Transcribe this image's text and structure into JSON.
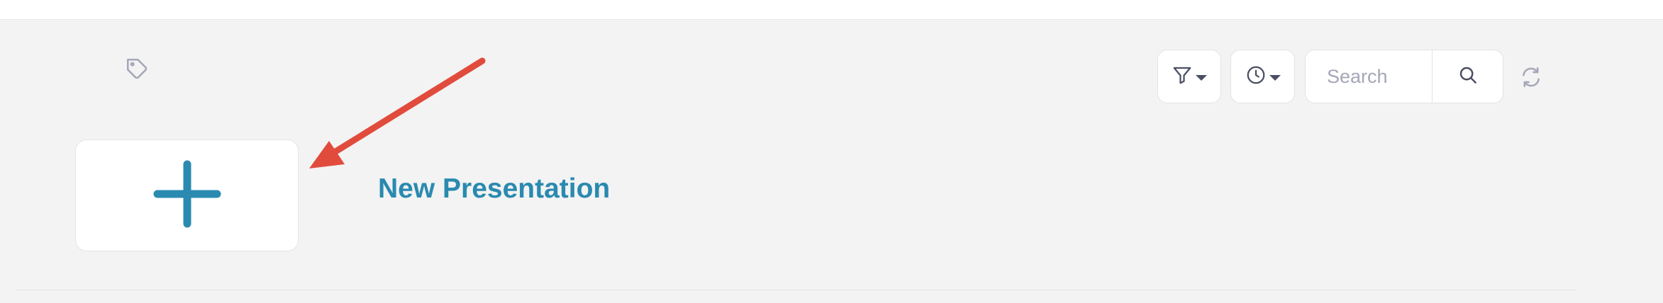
{
  "search": {
    "placeholder": "Search"
  },
  "new_item": {
    "label": "New Presentation"
  },
  "colors": {
    "accent": "#2a8ab0",
    "annotation_arrow": "#e14b3c",
    "icon": "#4b4f63",
    "muted_icon": "#a5a7b8"
  },
  "icons": {
    "tag": "tag-icon",
    "filter": "filter-icon",
    "history": "clock-icon",
    "search": "search-icon",
    "refresh": "refresh-icon",
    "add": "plus-icon"
  }
}
